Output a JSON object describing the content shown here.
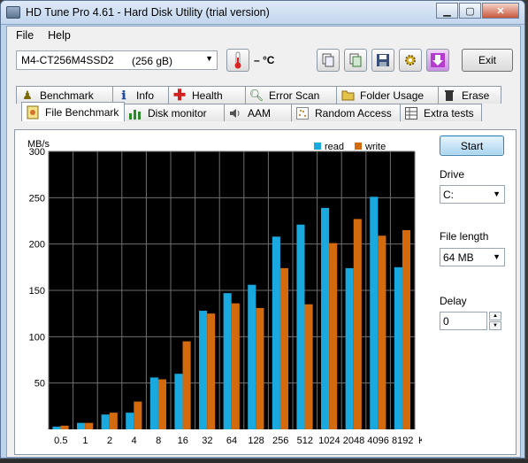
{
  "window": {
    "title": "HD Tune Pro 4.61 - Hard Disk Utility (trial version)"
  },
  "menu": {
    "file": "File",
    "help": "Help"
  },
  "toolbar": {
    "drive_name": "M4-CT256M4SSD2",
    "drive_size": "(256 gB)",
    "temperature": "– °C",
    "exit_label": "Exit"
  },
  "tabs_top": [
    {
      "label": "Benchmark",
      "icon": "gauge-icon"
    },
    {
      "label": "Info",
      "icon": "info-icon"
    },
    {
      "label": "Health",
      "icon": "health-cross-icon"
    },
    {
      "label": "Error Scan",
      "icon": "magnifier-icon"
    },
    {
      "label": "Folder Usage",
      "icon": "folder-icon"
    },
    {
      "label": "Erase",
      "icon": "trash-icon"
    }
  ],
  "tabs_bottom": [
    {
      "label": "File Benchmark",
      "icon": "file-benchmark-icon",
      "active": true
    },
    {
      "label": "Disk monitor",
      "icon": "bar-chart-icon"
    },
    {
      "label": "AAM",
      "icon": "speaker-icon"
    },
    {
      "label": "Random Access",
      "icon": "scatter-icon"
    },
    {
      "label": "Extra tests",
      "icon": "table-icon"
    }
  ],
  "controls": {
    "start_label": "Start",
    "drive_label": "Drive",
    "drive_value": "C:",
    "file_length_label": "File length",
    "file_length_value": "64 MB",
    "delay_label": "Delay",
    "delay_value": "0"
  },
  "colors": {
    "read": "#1aa9de",
    "write": "#d46a0e",
    "plot_bg": "#000000",
    "grid": "#707070"
  },
  "chart_data": {
    "type": "bar",
    "ylabel": "MB/s",
    "xunit": "KB",
    "ylim": [
      0,
      300
    ],
    "yticks": [
      50,
      100,
      150,
      200,
      250,
      300
    ],
    "legend_position": "top-right",
    "categories": [
      "0.5",
      "1",
      "2",
      "4",
      "8",
      "16",
      "32",
      "64",
      "128",
      "256",
      "512",
      "1024",
      "2048",
      "4096",
      "8192"
    ],
    "series": [
      {
        "name": "read",
        "values": [
          3,
          7,
          16,
          18,
          56,
          60,
          128,
          147,
          156,
          208,
          221,
          239,
          174,
          251,
          175
        ]
      },
      {
        "name": "write",
        "values": [
          4,
          7,
          18,
          30,
          54,
          95,
          125,
          136,
          131,
          174,
          135,
          201,
          227,
          209,
          215
        ]
      }
    ]
  }
}
